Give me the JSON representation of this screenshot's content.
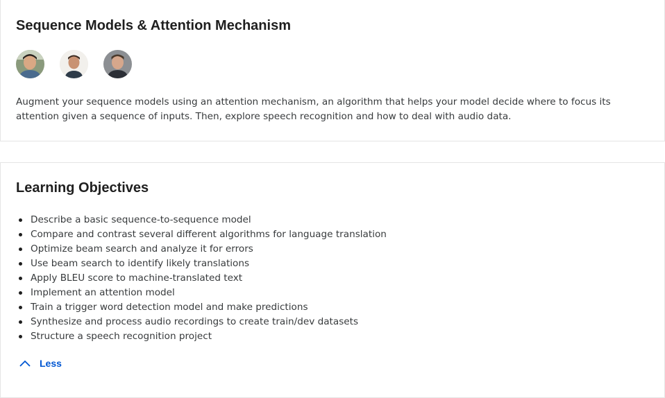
{
  "module": {
    "title": "Sequence Models & Attention Mechanism",
    "instructors": [
      {
        "icon": "instructor-avatar-1"
      },
      {
        "icon": "instructor-avatar-2"
      },
      {
        "icon": "instructor-avatar-3"
      }
    ],
    "description": "Augment your sequence models using an attention mechanism, an algorithm that helps your model decide where to focus its attention given a sequence of inputs. Then, explore speech recognition and how to deal with audio data."
  },
  "objectives": {
    "title": "Learning Objectives",
    "items": [
      "Describe a basic sequence-to-sequence model",
      "Compare and contrast several different algorithms for language translation",
      "Optimize beam search and analyze it for errors",
      "Use beam search to identify likely translations",
      "Apply BLEU score to machine-translated text",
      "Implement an attention model",
      "Train a trigger word detection model and make predictions",
      "Synthesize and process audio recordings to create train/dev datasets",
      "Structure a speech recognition project"
    ],
    "toggle_label": "Less",
    "toggle_icon": "chevron-up-icon"
  },
  "colors": {
    "accent": "#0056d2",
    "text": "#373a3c",
    "heading": "#1f1f1f",
    "border": "#e5e5e5"
  }
}
